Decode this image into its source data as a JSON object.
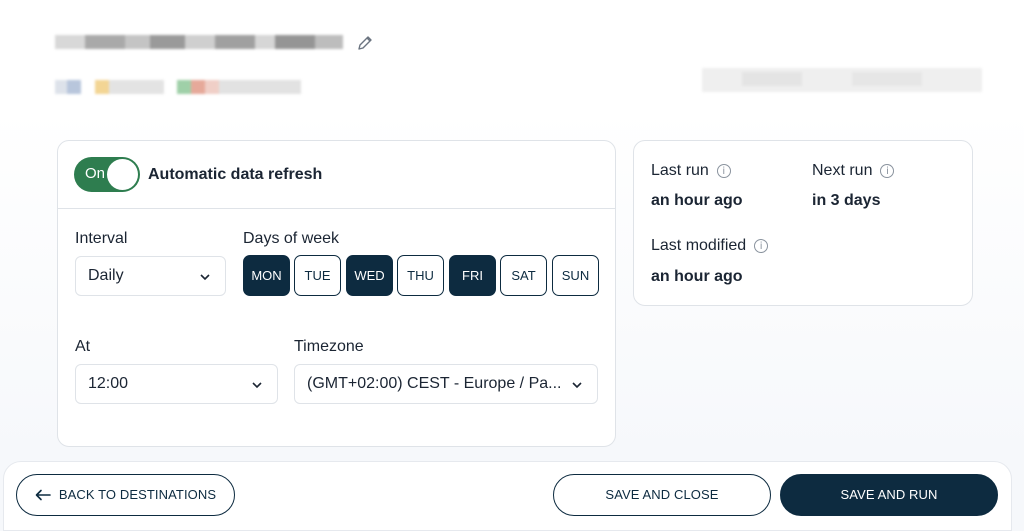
{
  "refresh": {
    "toggle_label": "On",
    "title": "Automatic data refresh",
    "interval_label": "Interval",
    "interval_value": "Daily",
    "days_label": "Days of week",
    "days": [
      {
        "label": "MON",
        "selected": true
      },
      {
        "label": "TUE",
        "selected": false
      },
      {
        "label": "WED",
        "selected": true
      },
      {
        "label": "THU",
        "selected": false
      },
      {
        "label": "FRI",
        "selected": true
      },
      {
        "label": "SAT",
        "selected": false
      },
      {
        "label": "SUN",
        "selected": false
      }
    ],
    "at_label": "At",
    "at_value": "12:00",
    "timezone_label": "Timezone",
    "timezone_value": "(GMT+02:00) CEST - Europe / Pa..."
  },
  "status": {
    "last_run_label": "Last run",
    "last_run_value": "an hour ago",
    "next_run_label": "Next run",
    "next_run_value": "in 3 days",
    "last_modified_label": "Last modified",
    "last_modified_value": "an hour ago"
  },
  "footer": {
    "back_label": "BACK TO DESTINATIONS",
    "save_close_label": "SAVE AND CLOSE",
    "save_run_label": "SAVE AND RUN"
  },
  "colors": {
    "primary": "#0d2b40",
    "toggle_on": "#2e7d4f",
    "border": "#dfe3e8"
  },
  "icons": {
    "edit": "pencil-icon",
    "info": "info-icon",
    "chevron": "chevron-down-icon",
    "back": "arrow-left-icon"
  }
}
